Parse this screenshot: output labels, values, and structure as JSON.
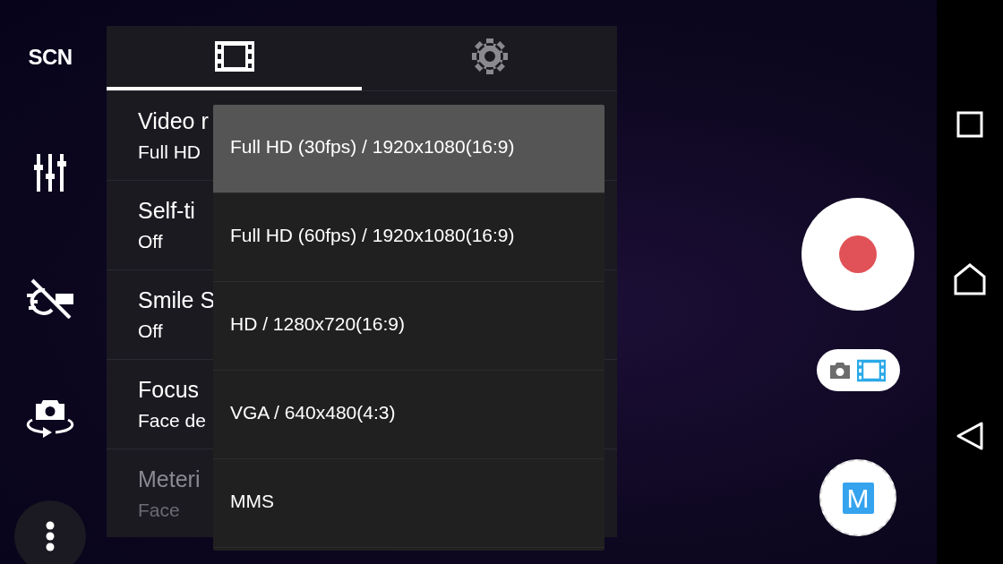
{
  "left_bar": {
    "scene_label": "SCN"
  },
  "settings_panel": {
    "tabs": [
      {
        "kind": "video",
        "selected": true
      },
      {
        "kind": "settings",
        "selected": false
      }
    ],
    "items": [
      {
        "title": "Video r",
        "value": "Full HD",
        "disabled": false
      },
      {
        "title": "Self-ti",
        "value": "Off",
        "disabled": false
      },
      {
        "title": "Smile S",
        "value": "Off",
        "disabled": false
      },
      {
        "title": "Focus",
        "value": "Face de",
        "disabled": false
      },
      {
        "title": "Meteri",
        "value": "Face",
        "disabled": true
      }
    ]
  },
  "resolution_menu": {
    "options": [
      {
        "label": "Full HD (30fps) / 1920x1080(16:9)",
        "selected": true
      },
      {
        "label": "Full HD (60fps) / 1920x1080(16:9)",
        "selected": false
      },
      {
        "label": "HD / 1280x720(16:9)",
        "selected": false
      },
      {
        "label": "VGA / 640x480(4:3)",
        "selected": false
      },
      {
        "label": "MMS",
        "selected": false
      }
    ]
  },
  "capture": {
    "modes": [
      {
        "kind": "photo",
        "selected": false
      },
      {
        "kind": "video",
        "selected": true
      }
    ],
    "manual_button": {
      "label": "M"
    }
  }
}
